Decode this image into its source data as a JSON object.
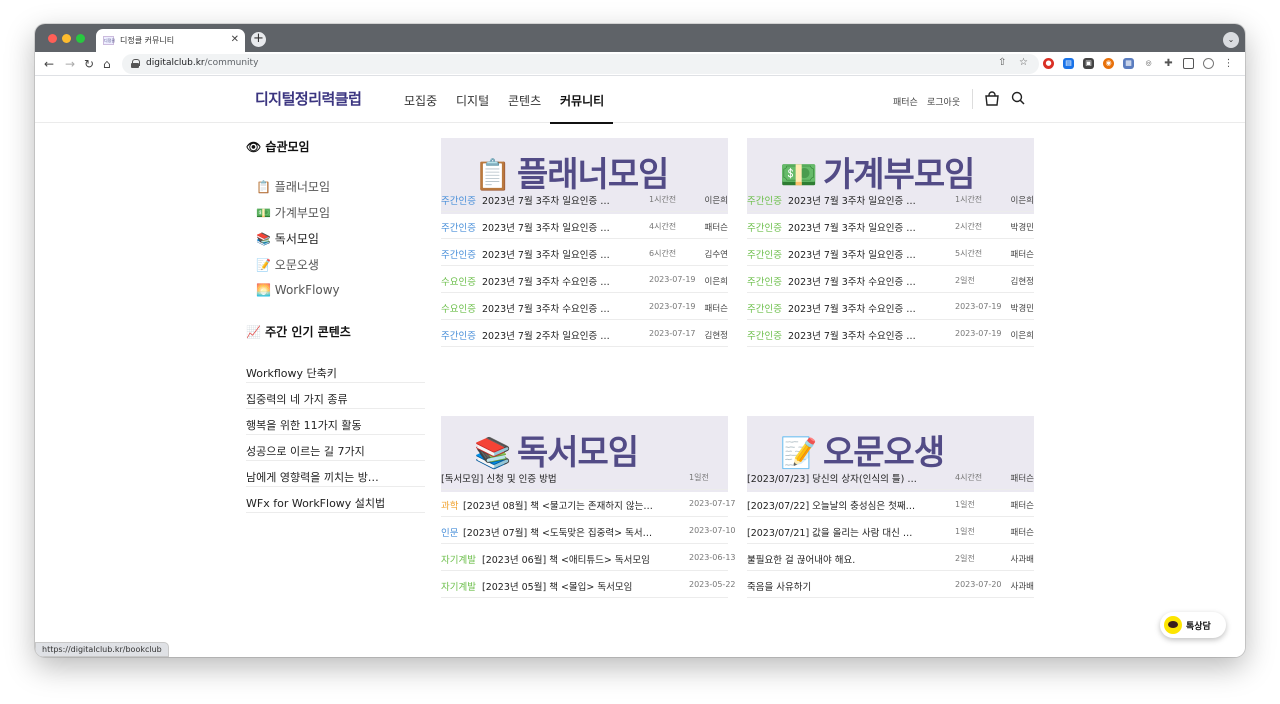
{
  "browser": {
    "tab_title": "디정클 커뮤니티",
    "tab_favicon": "디정클",
    "url_host": "digitalclub.kr",
    "url_path": "/community",
    "status_url": "https://digitalclub.kr/bookclub"
  },
  "header": {
    "logo": "디지털정리력클럽",
    "nav": [
      "모집중",
      "디지털",
      "콘텐츠",
      "커뮤니티"
    ],
    "active_nav": "커뮤니티",
    "user_link": "패터슨",
    "logout_link": "로그아웃"
  },
  "sidebar": {
    "habit_title": "습관모임",
    "habit_icon": "👁",
    "habit_items": [
      {
        "icon": "📋",
        "label": "플래너모임"
      },
      {
        "icon": "💵",
        "label": "가계부모임"
      },
      {
        "icon": "📚",
        "label": "독서모임"
      },
      {
        "icon": "📝",
        "label": "오문오생"
      },
      {
        "icon": "🌅",
        "label": "WorkFlowy"
      }
    ],
    "popular_title": "주간 인기 콘텐츠",
    "popular_icon": "📈",
    "popular_items": [
      "Workflowy 단축키",
      "집중력의 네 가지 종류",
      "행복을 위한 11가지 활동",
      "성공으로 이르는 길 7가지",
      "남에게 영향력을 끼치는 방…",
      "WFx for WorkFlowy 설치법"
    ]
  },
  "boards": [
    {
      "icon": "📋",
      "title": "플래너모임",
      "posts": [
        {
          "cat": "주간인증",
          "color": "blue",
          "title": "2023년 7월 3주차 일요인증 …",
          "time": "1시간전",
          "author": "이은희"
        },
        {
          "cat": "주간인증",
          "color": "blue",
          "title": "2023년 7월 3주차 일요인증 …",
          "time": "4시간전",
          "author": "패터슨"
        },
        {
          "cat": "주간인증",
          "color": "blue",
          "title": "2023년 7월 3주차 일요인증 …",
          "time": "6시간전",
          "author": "김수연"
        },
        {
          "cat": "수요인증",
          "color": "green",
          "title": "2023년 7월 3주차 수요인증 …",
          "time": "2023-07-19",
          "author": "이은희"
        },
        {
          "cat": "수요인증",
          "color": "green",
          "title": "2023년 7월 3주차 수요인증 …",
          "time": "2023-07-19",
          "author": "패터슨"
        },
        {
          "cat": "주간인증",
          "color": "blue",
          "title": "2023년 7월 2주차 일요인증 …",
          "time": "2023-07-17",
          "author": "김현정"
        }
      ]
    },
    {
      "icon": "💵",
      "title": "가계부모임",
      "posts": [
        {
          "cat": "주간인증",
          "color": "green",
          "title": "2023년 7월 3주차 일요인증 …",
          "time": "1시간전",
          "author": "이은희"
        },
        {
          "cat": "주간인증",
          "color": "green",
          "title": "2023년 7월 3주차 일요인증 …",
          "time": "2시간전",
          "author": "박경민"
        },
        {
          "cat": "주간인증",
          "color": "green",
          "title": "2023년 7월 3주차 일요인증 …",
          "time": "5시간전",
          "author": "패터슨"
        },
        {
          "cat": "주간인증",
          "color": "green",
          "title": "2023년 7월 3주차 수요인증 …",
          "time": "2일전",
          "author": "김현정"
        },
        {
          "cat": "주간인증",
          "color": "green",
          "title": "2023년 7월 3주차 수요인증 …",
          "time": "2023-07-19",
          "author": "박경민"
        },
        {
          "cat": "주간인증",
          "color": "green",
          "title": "2023년 7월 3주차 수요인증 …",
          "time": "2023-07-19",
          "author": "이은희"
        }
      ]
    },
    {
      "icon": "📚",
      "title": "독서모임",
      "posts": [
        {
          "cat": "",
          "color": "",
          "title": "[독서모임] 신청 및 인증 방법",
          "time": "1일전",
          "author": ""
        },
        {
          "cat": "과학",
          "color": "orange",
          "title": "[2023년 08월] 책 <물고기는 존재하지 않는…",
          "time": "2023-07-17",
          "author": ""
        },
        {
          "cat": "인문",
          "color": "blue",
          "title": "[2023년 07월] 책 <도둑맞은 집중력> 독서…",
          "time": "2023-07-10",
          "author": ""
        },
        {
          "cat": "자기계발",
          "color": "green",
          "title": "[2023년 06월] 책 <애티튜드> 독서모임",
          "time": "2023-06-13",
          "author": ""
        },
        {
          "cat": "자기계발",
          "color": "green",
          "title": "[2023년 05월] 책 <몰입> 독서모임",
          "time": "2023-05-22",
          "author": ""
        }
      ]
    },
    {
      "icon": "📝",
      "title": "오문오생",
      "posts": [
        {
          "cat": "",
          "color": "",
          "title": "[2023/07/23] 당신의 상자(인식의 틀) …",
          "time": "4시간전",
          "author": "패터슨"
        },
        {
          "cat": "",
          "color": "",
          "title": "[2023/07/22] 오늘날의 충성심은 첫째…",
          "time": "1일전",
          "author": "패터슨"
        },
        {
          "cat": "",
          "color": "",
          "title": "[2023/07/21] 값을 올리는 사람 대신 …",
          "time": "1일전",
          "author": "패터슨"
        },
        {
          "cat": "",
          "color": "",
          "title": "불필요한 걸 끊어내야 해요.",
          "time": "2일전",
          "author": "사과배"
        },
        {
          "cat": "",
          "color": "",
          "title": "죽음을 사유하기",
          "time": "2023-07-20",
          "author": "사과배"
        }
      ]
    }
  ],
  "chat_button": "톡상담"
}
